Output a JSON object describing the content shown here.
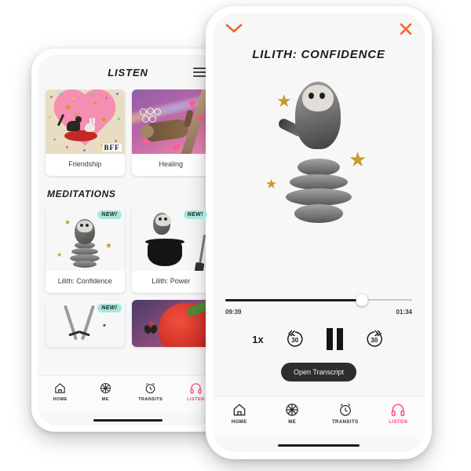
{
  "colors": {
    "accent_orange": "#f4622a",
    "accent_pink": "#ff3d8f",
    "badge_mint": "#a8e6dc",
    "screen_bg": "#f7f7f7",
    "text_dark": "#1c1c1c",
    "star_gold": "#c79a2b"
  },
  "listen_screen": {
    "header": {
      "title": "LISTEN",
      "menu_icon": "hamburger-icon"
    },
    "featured": [
      {
        "label": "Friendship",
        "art": "cat-and-rabbit-heart-collage"
      },
      {
        "label": "Healing",
        "art": "sloth-on-branch-rainbow-collage"
      }
    ],
    "section": {
      "title": "MEDITATIONS"
    },
    "meditations": [
      {
        "label": "Lilith: Confidence",
        "badge": "NEW!",
        "art": "owl-on-stones"
      },
      {
        "label": "Lilith: Power",
        "badge": "NEW!",
        "art": "owl-on-cauldron-with-broom"
      },
      {
        "label": "",
        "badge": "NEW!",
        "art": "crossed-daggers"
      },
      {
        "label": "",
        "badge": "",
        "art": "strawberry-with-butterfly"
      }
    ],
    "nav": [
      {
        "label": "HOME",
        "icon": "home-icon",
        "active": false
      },
      {
        "label": "ME",
        "icon": "wheel-icon",
        "active": false
      },
      {
        "label": "TRANSITS",
        "icon": "alarm-clock-icon",
        "active": false
      },
      {
        "label": "LISTEN",
        "icon": "headphones-icon",
        "active": true
      }
    ]
  },
  "player_screen": {
    "header": {
      "collapse_icon": "chevron-down-icon",
      "close_icon": "close-icon"
    },
    "title": "LILITH: CONFIDENCE",
    "artwork": "barn-owl-on-stacked-stones-with-gold-stars",
    "progress": {
      "elapsed": "09:39",
      "remaining": "01:34",
      "percent": 73
    },
    "controls": {
      "speed": "1x",
      "rewind": "30",
      "forward": "30",
      "play_state": "paused"
    },
    "transcript_button": "Open Transcript",
    "nav": [
      {
        "label": "HOME",
        "icon": "home-icon",
        "active": false
      },
      {
        "label": "ME",
        "icon": "wheel-icon",
        "active": false
      },
      {
        "label": "TRANSITS",
        "icon": "alarm-clock-icon",
        "active": false
      },
      {
        "label": "LISTEN",
        "icon": "headphones-icon",
        "active": true
      }
    ]
  }
}
